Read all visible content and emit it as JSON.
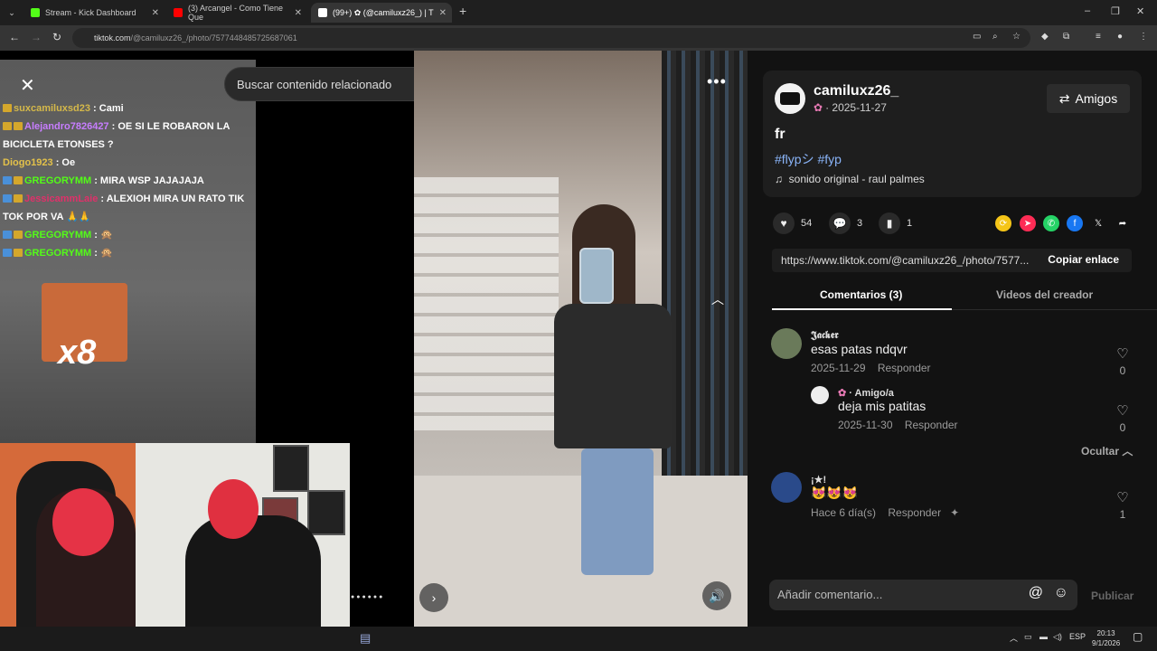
{
  "browser": {
    "tabs": [
      {
        "title": "Stream - Kick Dashboard",
        "color": "#53fc18"
      },
      {
        "title": "(3) Arcangel - Como Tiene Que",
        "color": "#ff0000"
      },
      {
        "title": "(99+) ✿ (@camiluxz26_) | T",
        "color": "#ffffff"
      }
    ],
    "new_tab": "+",
    "url_host": "tiktok.com",
    "url_path": "/@camiluxz26_/photo/7577448485725687061"
  },
  "search": {
    "placeholder": "Buscar contenido relacionado"
  },
  "chat": [
    {
      "user": "suxcamiluxsd23",
      "msg": " : Cami",
      "user_color": "#d4b84a"
    },
    {
      "user": "Alejandro7826427",
      "msg": " : OE SI LE ROBARON LA BICICLETA ETONSES ?",
      "user_color": "#c77dff"
    },
    {
      "user": "Diogo1923",
      "msg": " : Oe",
      "user_color": "#e3c14a"
    },
    {
      "user": "GREGORYMM",
      "msg": " : MIRA WSP JAJAJAJA",
      "user_color": "#53fc18"
    },
    {
      "user": "JessicammLaie",
      "msg": " : ALEXIOH MIRA UN RATO TIK TOK POR VA 🙏🙏",
      "user_color": "#e0306a"
    },
    {
      "user": "GREGORYMM",
      "msg": " :",
      "user_color": "#53fc18"
    },
    {
      "user": "GREGORYMM",
      "msg": " :",
      "user_color": "#53fc18"
    }
  ],
  "emote": {
    "multiplier": "x8"
  },
  "post": {
    "username": "camiluxz26_",
    "date": "· 2025-11-27",
    "friends_label": "Amigos",
    "description": "fr",
    "tags": "#flypシ #fyp",
    "sound": "sonido original - raul palmes",
    "likes": "54",
    "comments_count": "3",
    "saves": "1",
    "link": "https://www.tiktok.com/@camiluxz26_/photo/7577...",
    "copy_link": "Copiar enlace"
  },
  "tabs": {
    "comments": "Comentarios (3)",
    "creator": "Videos del creador"
  },
  "comments": [
    {
      "user": "𝕵𝖆𝖈𝖐𝖊𝖗",
      "text": "esas patas ndqvr",
      "date": "2025-11-29",
      "reply": "Responder",
      "likes": "0"
    },
    {
      "user": "· Amigo/a",
      "text": "deja mis patitas",
      "date": "2025-11-30",
      "reply": "Responder",
      "likes": "0"
    },
    {
      "user": "¡★!",
      "text": "😻😻😻",
      "date": "Hace 6 día(s)",
      "reply": "Responder",
      "likes": "1"
    }
  ],
  "hide_label": "Ocultar",
  "comment_input": {
    "placeholder": "Añadir comentario...",
    "post_label": "Publicar"
  },
  "taskbar": {
    "lang": "ESP",
    "time": "20:13",
    "date": "9/1/2026"
  }
}
